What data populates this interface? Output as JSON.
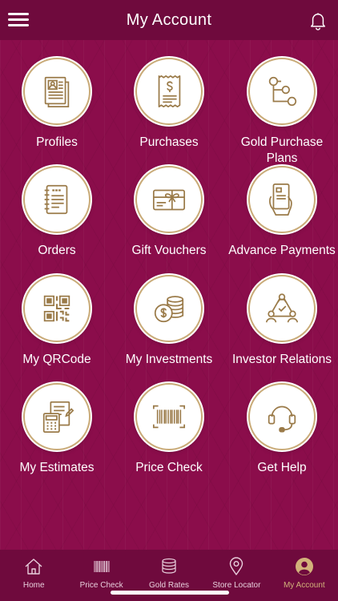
{
  "header": {
    "title": "My Account"
  },
  "tiles": [
    {
      "label": "Profiles",
      "icon": "profile-document-icon"
    },
    {
      "label": "Purchases",
      "icon": "receipt-icon"
    },
    {
      "label": "Gold Purchase Plans",
      "icon": "flowchart-icon"
    },
    {
      "label": "Orders",
      "icon": "list-notepad-icon"
    },
    {
      "label": "Gift Vouchers",
      "icon": "gift-card-icon"
    },
    {
      "label": "Advance Payments",
      "icon": "card-in-hand-icon"
    },
    {
      "label": "My QRCode",
      "icon": "qr-code-icon"
    },
    {
      "label": "My Investments",
      "icon": "coin-stack-icon"
    },
    {
      "label": "Investor Relations",
      "icon": "people-network-icon"
    },
    {
      "label": "My Estimates",
      "icon": "calculator-notepad-icon"
    },
    {
      "label": "Price Check",
      "icon": "barcode-icon"
    },
    {
      "label": "Get Help",
      "icon": "headset-icon"
    }
  ],
  "tabs": [
    {
      "label": "Home",
      "icon": "home-icon"
    },
    {
      "label": "Price Check",
      "icon": "barcode-icon"
    },
    {
      "label": "Gold Rates",
      "icon": "coins-icon"
    },
    {
      "label": "Store Locator",
      "icon": "map-pin-icon"
    },
    {
      "label": "My Account",
      "icon": "user-avatar-icon",
      "active": true
    }
  ],
  "colors": {
    "background": "#8b0d4b",
    "header": "#6f0a3d",
    "gold": "#c9ab78",
    "icon_brown": "#9a7a48"
  }
}
